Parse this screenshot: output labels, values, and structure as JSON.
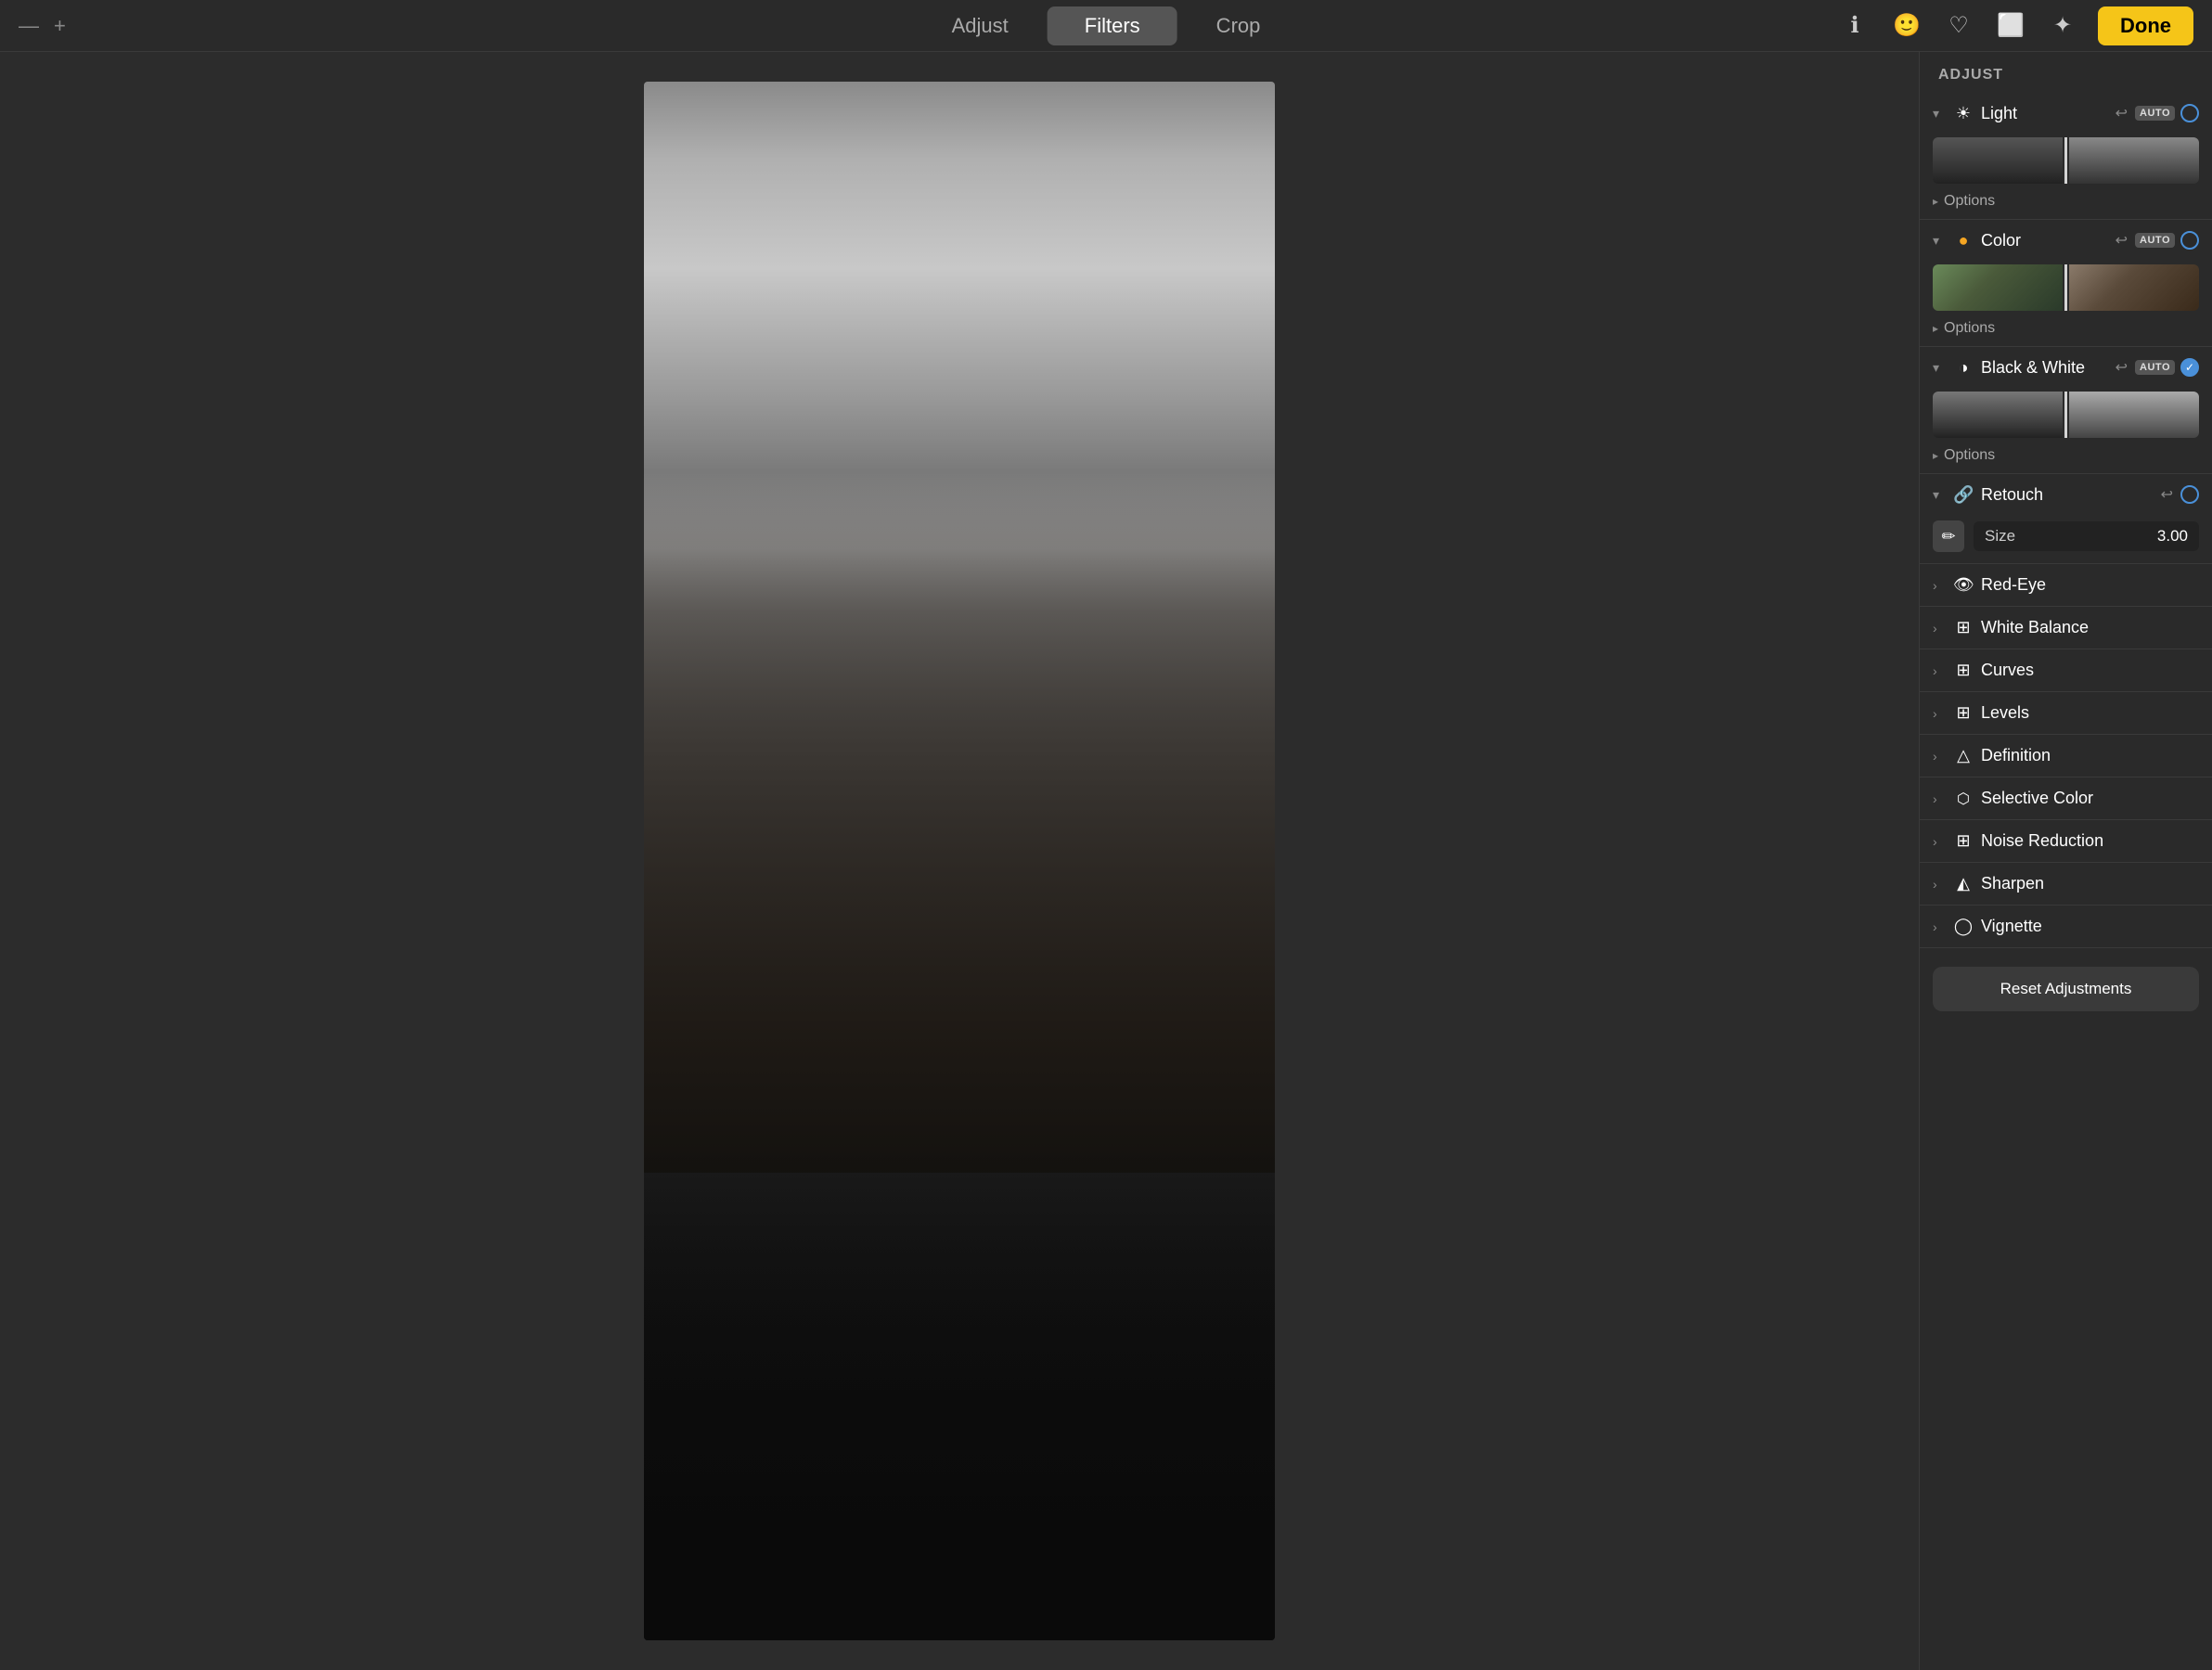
{
  "topbar": {
    "dash": "—",
    "plus": "+",
    "tabs": [
      {
        "label": "Adjust",
        "active": false
      },
      {
        "label": "Filters",
        "active": true
      },
      {
        "label": "Crop",
        "active": false
      }
    ],
    "done_label": "Done"
  },
  "panel": {
    "header": "ADJUST",
    "sections": [
      {
        "id": "light",
        "icon": "☀️",
        "title": "Light",
        "expanded": true,
        "has_auto": true,
        "has_undo": true,
        "indicator": "circle",
        "has_options": true
      },
      {
        "id": "color",
        "icon": "🔴",
        "title": "Color",
        "expanded": true,
        "has_auto": true,
        "has_undo": true,
        "indicator": "circle",
        "has_options": true
      },
      {
        "id": "bw",
        "icon": "◑",
        "title": "Black & White",
        "expanded": true,
        "has_auto": true,
        "has_undo": true,
        "indicator": "check",
        "has_options": true
      },
      {
        "id": "retouch",
        "icon": "🔗",
        "title": "Retouch",
        "expanded": true,
        "has_auto": false,
        "has_undo": true,
        "indicator": "circle",
        "size_label": "Size",
        "size_value": "3.00"
      }
    ],
    "collapsed_sections": [
      {
        "id": "red-eye",
        "icon": "👁",
        "label": "Red-Eye"
      },
      {
        "id": "white-balance",
        "icon": "⊞",
        "label": "White Balance"
      },
      {
        "id": "curves",
        "icon": "⊞",
        "label": "Curves"
      },
      {
        "id": "levels",
        "icon": "⊞",
        "label": "Levels"
      },
      {
        "id": "definition",
        "icon": "△",
        "label": "Definition"
      },
      {
        "id": "selective-color",
        "icon": "⬡",
        "label": "Selective Color"
      },
      {
        "id": "noise-reduction",
        "icon": "⊞",
        "label": "Noise Reduction"
      },
      {
        "id": "sharpen",
        "icon": "△",
        "label": "Sharpen"
      },
      {
        "id": "vignette",
        "icon": "◯",
        "label": "Vignette"
      }
    ],
    "reset_label": "Reset Adjustments",
    "options_label": "Options"
  }
}
